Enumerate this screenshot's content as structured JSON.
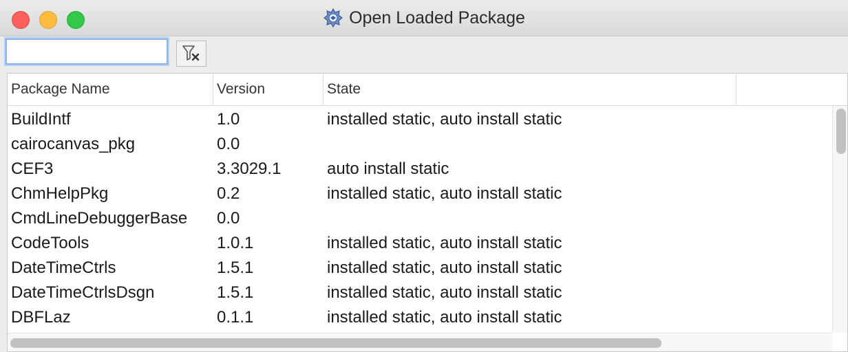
{
  "window": {
    "title": "Open Loaded Package",
    "app_icon": "lazarus-package-icon"
  },
  "toolbar": {
    "filter_value": "",
    "clear_filter_icon": "filter-clear-icon"
  },
  "columns": {
    "name": "Package Name",
    "version": "Version",
    "state": "State"
  },
  "rows": [
    {
      "name": "BuildIntf",
      "version": "1.0",
      "state": "installed static, auto install static"
    },
    {
      "name": "cairocanvas_pkg",
      "version": "0.0",
      "state": ""
    },
    {
      "name": "CEF3",
      "version": "3.3029.1",
      "state": "auto install static"
    },
    {
      "name": "ChmHelpPkg",
      "version": "0.2",
      "state": "installed static, auto install static"
    },
    {
      "name": "CmdLineDebuggerBase",
      "version": "0.0",
      "state": ""
    },
    {
      "name": "CodeTools",
      "version": "1.0.1",
      "state": "installed static, auto install static"
    },
    {
      "name": "DateTimeCtrls",
      "version": "1.5.1",
      "state": "installed static, auto install static"
    },
    {
      "name": "DateTimeCtrlsDsgn",
      "version": "1.5.1",
      "state": "installed static, auto install static"
    },
    {
      "name": "DBFLaz",
      "version": "0.1.1",
      "state": "installed static, auto install static"
    }
  ]
}
